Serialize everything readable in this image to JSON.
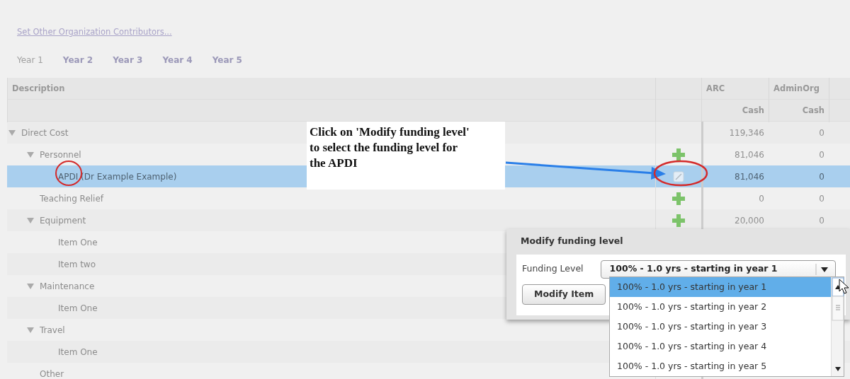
{
  "link": "Set Other Organization Contributors...",
  "year_tabs": [
    {
      "label": "Year 1",
      "selected": true
    },
    {
      "label": "Year 2",
      "selected": false
    },
    {
      "label": "Year 3",
      "selected": false
    },
    {
      "label": "Year 4",
      "selected": false
    },
    {
      "label": "Year 5",
      "selected": false
    }
  ],
  "table": {
    "columns": [
      {
        "label": "Description"
      },
      {
        "label": "ARC",
        "sub": "Cash"
      },
      {
        "label": "AdminOrg",
        "sub": "Cash"
      }
    ],
    "rows": [
      {
        "label": "Direct Cost",
        "expanded": true,
        "selected": false,
        "arc": "119,346",
        "admin_org": "0",
        "children": [
          {
            "label": "Personnel",
            "expanded": true,
            "selected": false,
            "actions": [
              {
                "kind": "add"
              }
            ],
            "arc": "81,046",
            "admin_org": "0",
            "children": [
              {
                "label": "APDI (Dr Example Example)",
                "selected": true,
                "actions": [
                  {
                    "kind": "edit"
                  }
                ],
                "arc": "81,046",
                "admin_org": "0"
              }
            ]
          },
          {
            "label": "Teaching Relief",
            "selected": false,
            "actions": [
              {
                "kind": "add"
              }
            ],
            "arc": "0",
            "admin_org": "0"
          },
          {
            "label": "Equipment",
            "expanded": true,
            "selected": false,
            "actions": [
              {
                "kind": "add"
              }
            ],
            "arc": "20,000",
            "admin_org": "0",
            "children": [
              {
                "label": "Item One",
                "selected": false
              },
              {
                "label": "Item two",
                "selected": false
              }
            ]
          },
          {
            "label": "Maintenance",
            "expanded": true,
            "selected": false,
            "children": [
              {
                "label": "Item One",
                "selected": false
              }
            ]
          },
          {
            "label": "Travel",
            "expanded": true,
            "selected": false,
            "children": [
              {
                "label": "Item One",
                "selected": false
              }
            ]
          },
          {
            "label": "Other",
            "selected": false
          }
        ]
      }
    ]
  },
  "callout": "Click on 'Modify funding level' to select the funding level for the APDI",
  "dialog": {
    "title": "Modify funding level",
    "field_label": "Funding Level",
    "value": "100% - 1.0 yrs - starting in year 1",
    "button": "Modify Item",
    "options": [
      {
        "label": "100% - 1.0 yrs - starting in year 1",
        "selected": true
      },
      {
        "label": "100% - 1.0 yrs - starting in year 2",
        "selected": false
      },
      {
        "label": "100% - 1.0 yrs - starting in year 3",
        "selected": false
      },
      {
        "label": "100% - 1.0 yrs - starting in year 4",
        "selected": false
      },
      {
        "label": "100% - 1.0 yrs - starting in year 5",
        "selected": false
      }
    ]
  }
}
